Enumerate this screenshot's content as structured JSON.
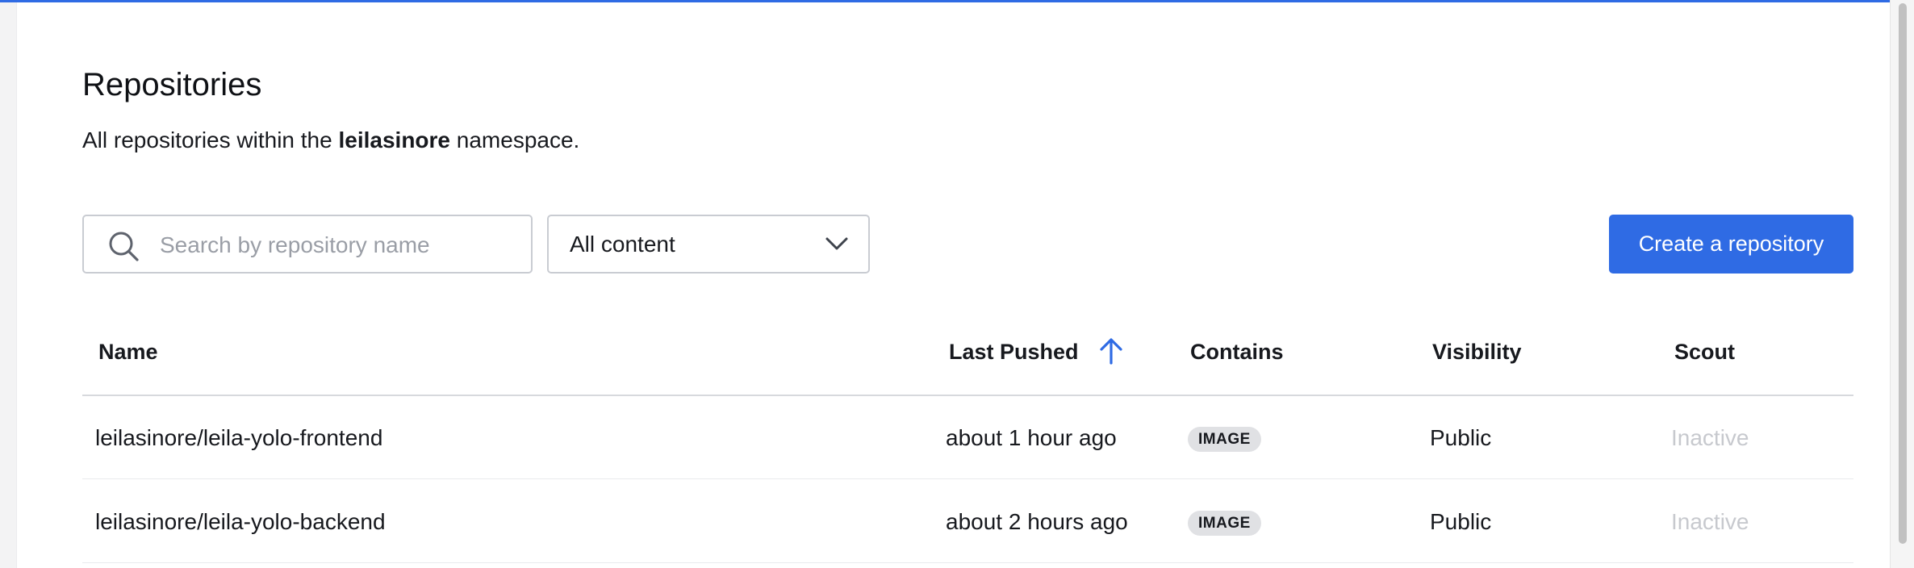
{
  "page": {
    "title": "Repositories",
    "subtitle_prefix": "All repositories within the ",
    "namespace": "leilasinore",
    "subtitle_suffix": " namespace."
  },
  "search": {
    "placeholder": "Search by repository name",
    "value": ""
  },
  "filter": {
    "selected": "All content"
  },
  "actions": {
    "create_label": "Create a repository"
  },
  "table": {
    "columns": [
      "Name",
      "Last Pushed",
      "Contains",
      "Visibility",
      "Scout"
    ],
    "sort": {
      "column": "Last Pushed",
      "direction": "ascending"
    },
    "rows": [
      {
        "name": "leilasinore/leila-yolo-frontend",
        "last_pushed": "about 1 hour ago",
        "contains": "IMAGE",
        "visibility": "Public",
        "scout": "Inactive"
      },
      {
        "name": "leilasinore/leila-yolo-backend",
        "last_pushed": "about 2 hours ago",
        "contains": "IMAGE",
        "visibility": "Public",
        "scout": "Inactive"
      }
    ]
  },
  "colors": {
    "accent": "#2f6be4",
    "badge_bg": "#e0e1e4",
    "muted_text": "#c7c9ce"
  },
  "icons": {
    "search": "search-icon",
    "dropdown": "chevron-down-icon",
    "sort": "arrow-up-icon"
  }
}
